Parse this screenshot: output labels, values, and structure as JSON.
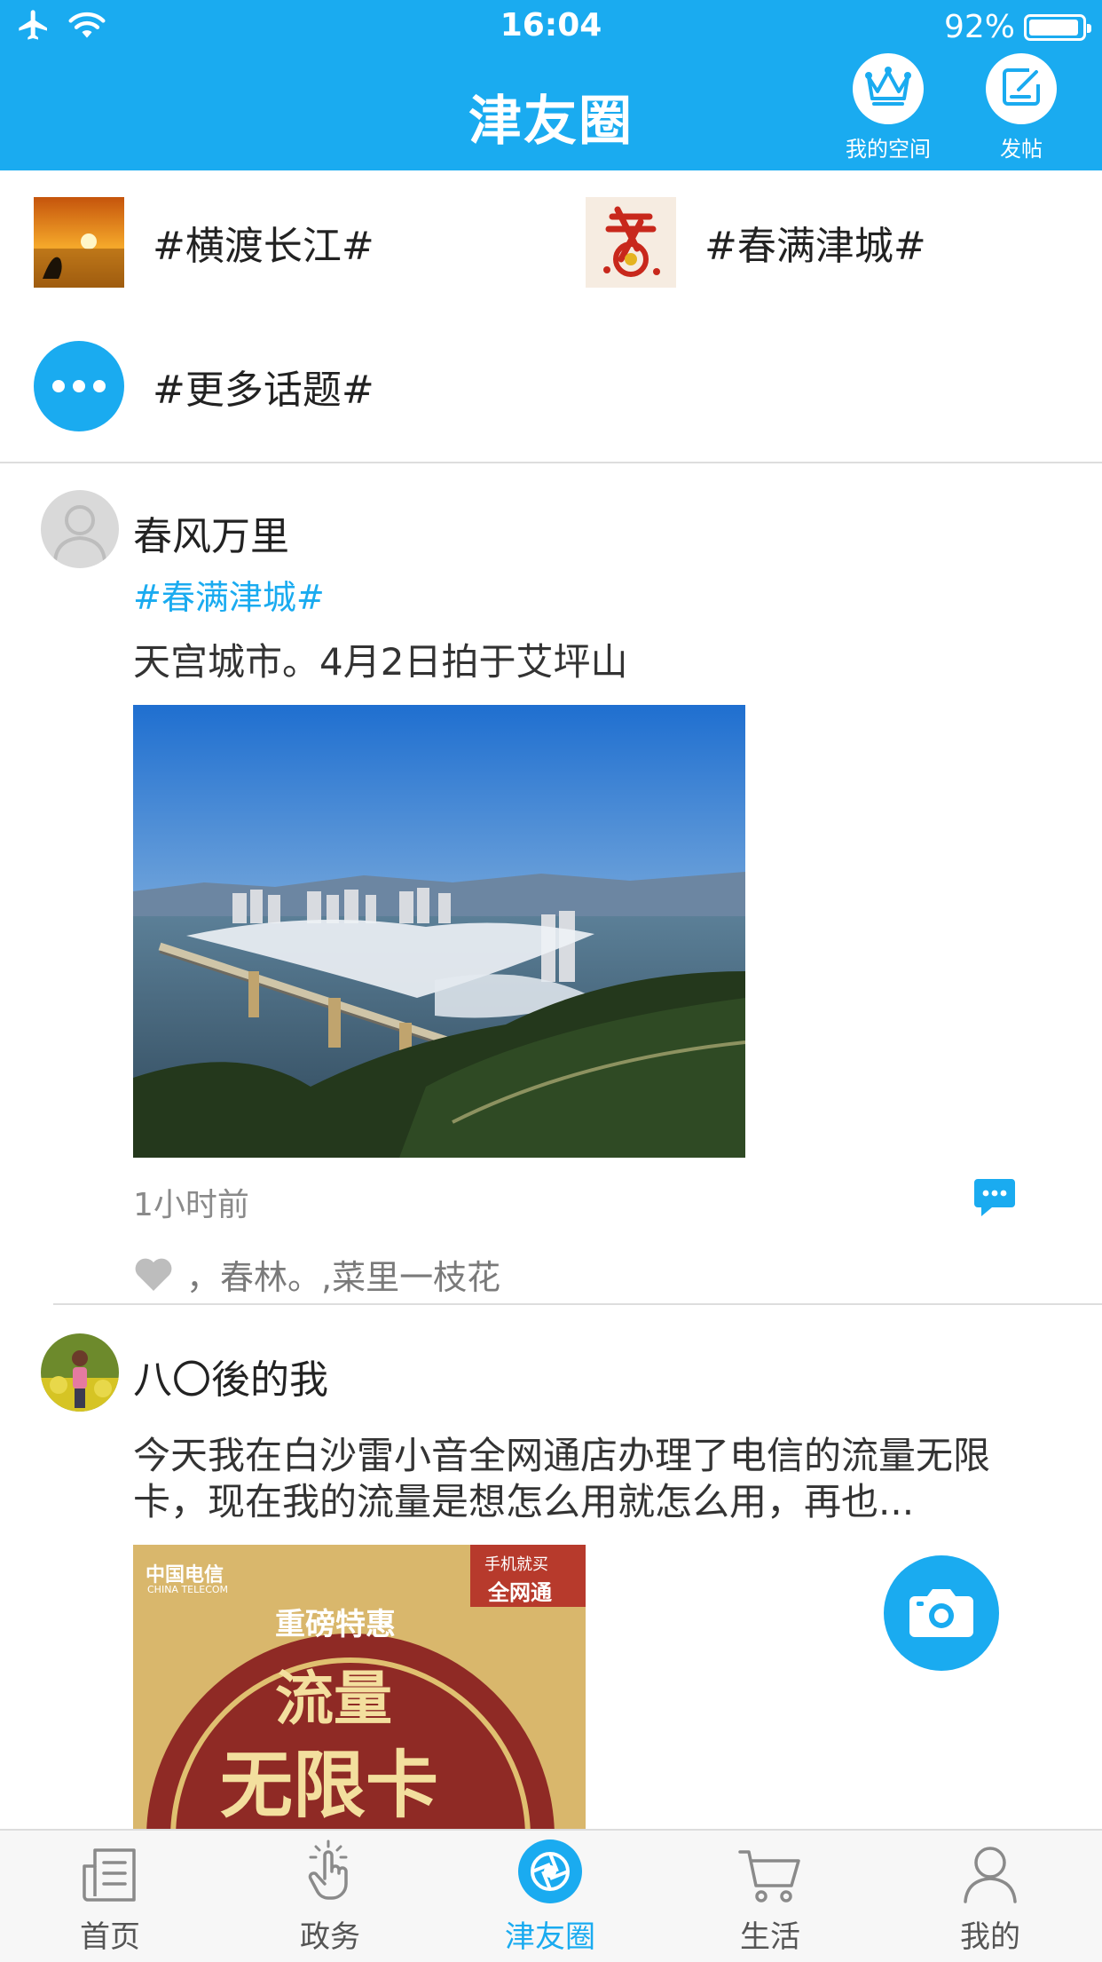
{
  "status_bar": {
    "time": "16:04",
    "battery": "92%"
  },
  "nav": {
    "title": "津友圈",
    "my_space": "我的空间",
    "post": "发帖"
  },
  "topics": [
    {
      "name": "#横渡长江#"
    },
    {
      "name": "#春满津城#"
    },
    {
      "name": "#更多话题#"
    }
  ],
  "posts": [
    {
      "user": "春风万里",
      "tag": "#春满津城#",
      "content": "天宫城市。4月2日拍于艾坪山",
      "time": "1小时前",
      "likes": "，春林。,菜里一枝花"
    },
    {
      "user": "八〇後的我",
      "content": "今天我在白沙雷小音全网通店办理了电信的流量无限卡，现在我的流量是想怎么用就怎么用，再也...",
      "image_text": {
        "brand": "中国电信",
        "brand_en": "CHINA TELECOM",
        "corner": "手机就买",
        "corner2": "全网通",
        "headline": "重磅特惠",
        "big1": "流量",
        "big2": "无限卡"
      }
    }
  ],
  "tabs": [
    {
      "label": "首页"
    },
    {
      "label": "政务"
    },
    {
      "label": "津友圈"
    },
    {
      "label": "生活"
    },
    {
      "label": "我的"
    }
  ],
  "colors": {
    "accent": "#1aabf0"
  }
}
